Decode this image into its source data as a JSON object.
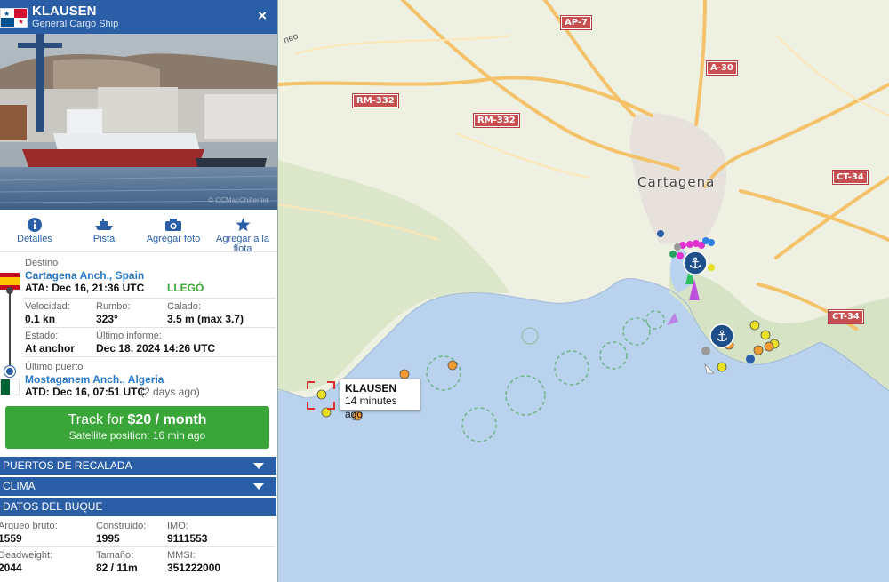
{
  "vessel": {
    "name": "KLAUSEN",
    "type": "General Cargo Ship",
    "close_icon": "×",
    "photo_credit": "© CCMacChillenlet"
  },
  "actions": [
    {
      "label": "Detalles",
      "icon": "info-icon"
    },
    {
      "label": "Pista",
      "icon": "ship-track-icon"
    },
    {
      "label": "Agregar foto",
      "icon": "camera-icon"
    },
    {
      "label": "Agregar a la flota",
      "icon": "star-icon"
    }
  ],
  "journey": {
    "destination_label": "Destino",
    "destination_port": "Cartagena Anch., Spain",
    "ata": "ATA: Dec 16, 21:36 UTC",
    "arrived_status": "LLEGÓ",
    "speed_label": "Velocidad:",
    "speed_value": "0.1 kn",
    "course_label": "Rumbo:",
    "course_value": "323°",
    "draught_label": "Calado:",
    "draught_value": "3.5 m (max 3.7)",
    "status_label": "Estado:",
    "status_value": "At anchor",
    "last_report_label": "Último informe:",
    "last_report_value": "Dec 18, 2024 14:26 UTC",
    "last_port_label": "Último puerto",
    "last_port": "Mostaganem Anch., Algeria",
    "atd": "ATD: Dec 16, 07:51 UTC",
    "atd_ago": "(2 days ago)"
  },
  "cta": {
    "title_prefix": "Track for ",
    "title_price": "$20 / month",
    "subtitle": "Satellite position: 16 min ago"
  },
  "sections": {
    "ports": "PUERTOS DE RECALADA",
    "weather": "CLIMA",
    "vessel_data": "DATOS DEL BUQUE"
  },
  "specs": {
    "gross_label": "Arqueo bruto:",
    "gross_value": "1559",
    "built_label": "Construido:",
    "built_value": "1995",
    "imo_label": "IMO:",
    "imo_value": "9111553",
    "dwt_label": "Deadweight:",
    "dwt_value": "2044",
    "size_label": "Tamaño:",
    "size_value": "82 / 11m",
    "mmsi_label": "MMSI:",
    "mmsi_value": "351222000"
  },
  "map": {
    "city": "Cartagena",
    "roads": [
      "AP-7",
      "A-30",
      "RM-332",
      "RM-332",
      "CT-34",
      "CT-34"
    ],
    "edge_label": "neo",
    "tooltip_name": "KLAUSEN",
    "tooltip_time": "14 minutes ago"
  },
  "colors": {
    "header_blue": "#2a5fa8",
    "cta_green": "#3aa63a",
    "link_blue": "#2a7ac8",
    "water": "#b9d3ee",
    "land": "#eef0e2"
  }
}
